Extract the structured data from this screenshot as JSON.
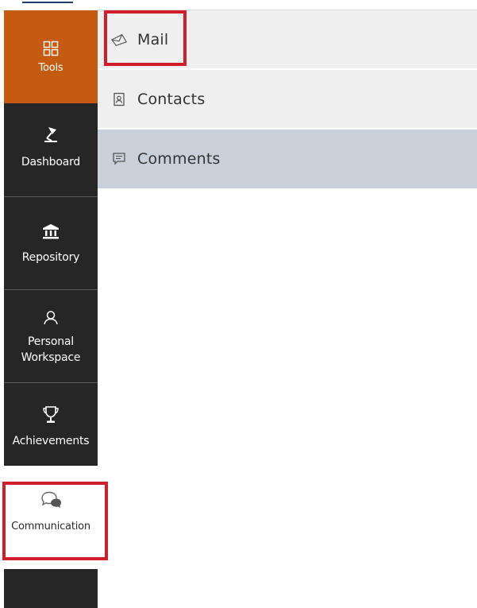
{
  "sidebar": {
    "items": [
      {
        "id": "tools",
        "label": "Tools",
        "icon": "grid-icon",
        "active": true
      },
      {
        "id": "dashboard",
        "label": "Dashboard",
        "icon": "desk-lamp-icon"
      },
      {
        "id": "repository",
        "label": "Repository",
        "icon": "bank-icon"
      },
      {
        "id": "workspace",
        "label": "Personal Workspace",
        "icon": "person-icon"
      },
      {
        "id": "achievements",
        "label": "Achievements",
        "icon": "trophy-icon"
      },
      {
        "id": "communication",
        "label": "Communication",
        "icon": "chat-bubbles-icon"
      }
    ]
  },
  "submenu": {
    "items": [
      {
        "id": "mail",
        "label": "Mail",
        "icon": "envelope-icon"
      },
      {
        "id": "contacts",
        "label": "Contacts",
        "icon": "contact-card-icon"
      },
      {
        "id": "comments",
        "label": "Comments",
        "icon": "comment-icon",
        "selected": true
      }
    ]
  },
  "colors": {
    "tools_accent": "#c55a11",
    "sidebar_bg": "#262626",
    "submenu_bg": "#efefef",
    "submenu_selected_bg": "#c9d0da",
    "highlight": "#d01f2b"
  }
}
